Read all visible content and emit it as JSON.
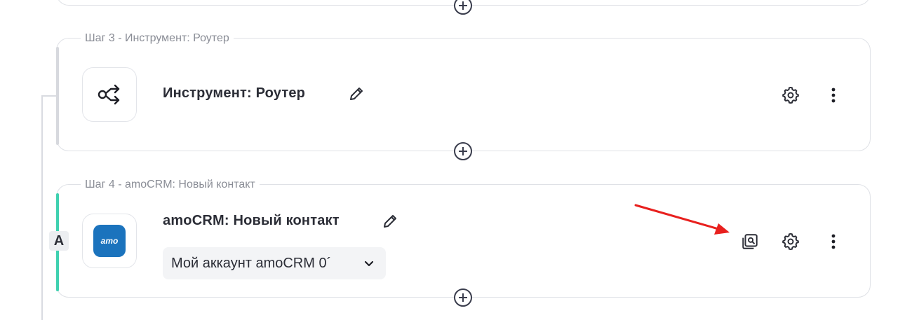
{
  "steps": [
    {
      "legend": "Шаг 3 - Инструмент: Роутер",
      "title": "Инструмент: Роутер",
      "icon": "router-icon"
    },
    {
      "legend": "Шаг 4 - amoCRM: Новый контакт",
      "title": "amoCRM: Новый контакт",
      "icon": "amocrm-logo",
      "logo_text": "amo",
      "account_select": "Мой аккаунт amoCRM 0´",
      "branch_label": "A"
    }
  ],
  "colors": {
    "accent_green": "#3fd1b0",
    "amo_blue": "#1b73bd",
    "arrow_red": "#e8201e"
  },
  "icons": [
    "plus-circle-icon",
    "pencil-icon",
    "gear-icon",
    "more-vertical-icon",
    "preview-icon",
    "chevron-down-icon"
  ]
}
